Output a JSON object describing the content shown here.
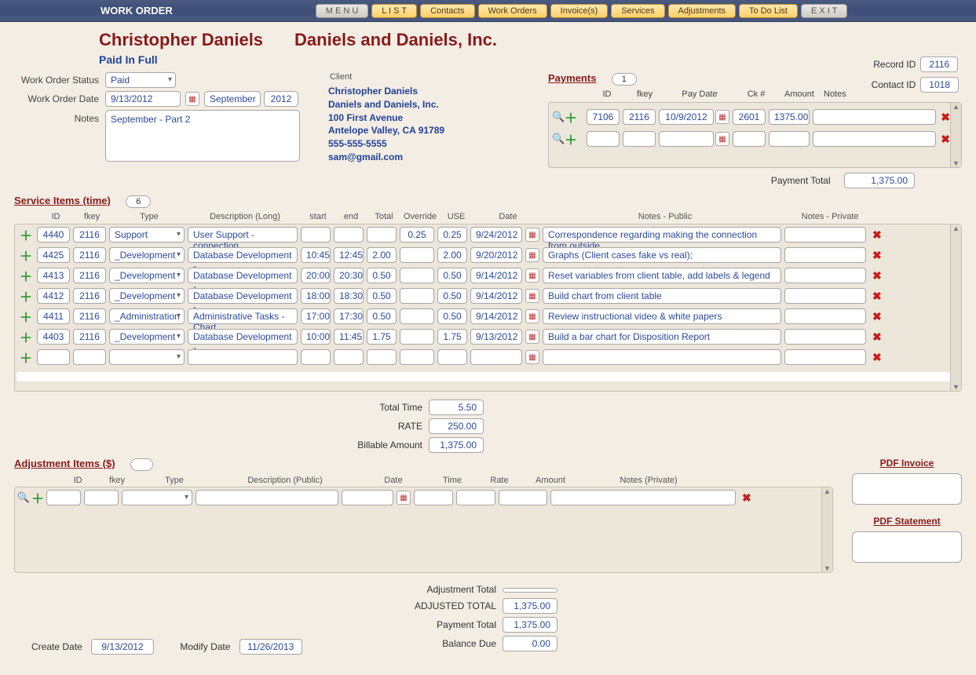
{
  "topbar": {
    "title": "WORK ORDER",
    "buttons": [
      "M E N U",
      "L I S T",
      "Contacts",
      "Work Orders",
      "Invoice(s)",
      "Services",
      "Adjustments",
      "To Do List",
      "E X I T"
    ]
  },
  "header": {
    "person": "Christopher Daniels",
    "company": "Daniels and Daniels, Inc.",
    "status_text": "Paid In Full",
    "record_id_label": "Record ID",
    "record_id": "2116",
    "contact_id_label": "Contact ID",
    "contact_id": "1018"
  },
  "wo": {
    "status_label": "Work Order Status",
    "status_value": "Paid",
    "date_label": "Work Order Date",
    "date_value": "9/13/2012",
    "month": "September",
    "year": "2012",
    "notes_label": "Notes",
    "notes_value": "September - Part 2"
  },
  "client": {
    "label": "Client",
    "name": "Christopher Daniels",
    "company": "Daniels and Daniels, Inc.",
    "addr1": "100 First Avenue",
    "addr2": "Antelope Valley, CA  91789",
    "phone": "555-555-5555",
    "email": "sam@gmail.com"
  },
  "payments": {
    "title": "Payments",
    "count": "1",
    "cols": [
      "ID",
      "fkey",
      "Pay Date",
      "Ck #",
      "Amount",
      "Notes"
    ],
    "rows": [
      {
        "id": "7106",
        "fkey": "2116",
        "date": "10/9/2012",
        "ck": "2601",
        "amount": "1375.00",
        "notes": ""
      }
    ],
    "payment_total_label": "Payment Total",
    "payment_total": "1,375.00"
  },
  "services": {
    "title": "Service Items (time)",
    "count": "6",
    "cols": [
      "ID",
      "fkey",
      "Type",
      "Description (Long)",
      "start",
      "end",
      "Total",
      "Override",
      "USE",
      "Date",
      "Notes - Public",
      "Notes - Private"
    ],
    "rows": [
      {
        "id": "4440",
        "fkey": "2116",
        "type": "Support",
        "desc": "User Support - connection",
        "start": "",
        "end": "",
        "total": "",
        "override": "0.25",
        "use": "0.25",
        "date": "9/24/2012",
        "npub": "Correspondence regarding making the connection from outside",
        "npriv": ""
      },
      {
        "id": "4425",
        "fkey": "2116",
        "type": "_Development",
        "desc": "Database Development -",
        "start": "10:45",
        "end": "12:45",
        "total": "2.00",
        "override": "",
        "use": "2.00",
        "date": "9/20/2012",
        "npub": "Graphs (Client cases fake vs real);",
        "npriv": ""
      },
      {
        "id": "4413",
        "fkey": "2116",
        "type": "_Development",
        "desc": "Database Development -",
        "start": "20:00",
        "end": "20:30",
        "total": "0.50",
        "override": "",
        "use": "0.50",
        "date": "9/14/2012",
        "npub": "Reset variables from client table, add labels & legend",
        "npriv": ""
      },
      {
        "id": "4412",
        "fkey": "2116",
        "type": "_Development",
        "desc": "Database Development -",
        "start": "18:00",
        "end": "18:30",
        "total": "0.50",
        "override": "",
        "use": "0.50",
        "date": "9/14/2012",
        "npub": "Build chart from client table",
        "npriv": ""
      },
      {
        "id": "4411",
        "fkey": "2116",
        "type": "_Administration",
        "desc": "Administrative Tasks - Chart",
        "start": "17:00",
        "end": "17:30",
        "total": "0.50",
        "override": "",
        "use": "0.50",
        "date": "9/14/2012",
        "npub": "Review instructional video & white papers",
        "npriv": ""
      },
      {
        "id": "4403",
        "fkey": "2116",
        "type": "_Development",
        "desc": "Database Development -",
        "start": "10:00",
        "end": "11:45",
        "total": "1.75",
        "override": "",
        "use": "1.75",
        "date": "9/13/2012",
        "npub": "Build a bar chart for Disposition Report",
        "npriv": ""
      }
    ],
    "totals": {
      "total_time_label": "Total Time",
      "total_time": "5.50",
      "rate_label": "RATE",
      "rate": "250.00",
      "billable_label": "Billable Amount",
      "billable": "1,375.00"
    }
  },
  "adjustments": {
    "title": "Adjustment Items ($)",
    "cols": [
      "ID",
      "fkey",
      "Type",
      "Description (Public)",
      "Date",
      "Time",
      "Rate",
      "Amount",
      "Notes (Private)"
    ]
  },
  "bottom_totals": {
    "adjustment_total_label": "Adjustment Total",
    "adjustment_total": "",
    "adjusted_total_label": "ADJUSTED TOTAL",
    "adjusted_total": "1,375.00",
    "payment_total_label": "Payment Total",
    "payment_total": "1,375.00",
    "balance_due_label": "Balance Due",
    "balance_due": "0.00"
  },
  "footer_dates": {
    "create_label": "Create Date",
    "create": "9/13/2012",
    "modify_label": "Modify Date",
    "modify": "11/26/2013"
  },
  "pdf": {
    "invoice": "PDF Invoice",
    "statement": "PDF Statement"
  }
}
